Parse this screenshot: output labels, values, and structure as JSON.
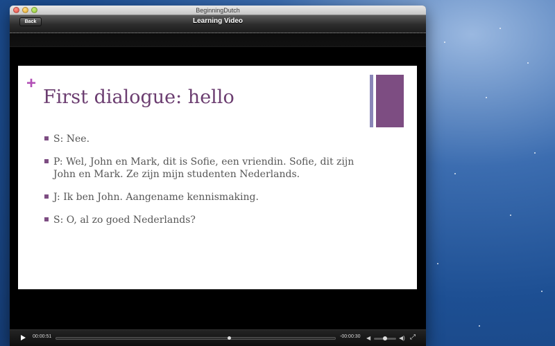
{
  "window": {
    "title": "BeginningDutch"
  },
  "navbar": {
    "back_label": "Back",
    "title": "Learning Video"
  },
  "slide": {
    "plus_symbol": "+",
    "title": "First dialogue: hello",
    "bullets": [
      "S: Nee.",
      "P:  Wel, John en Mark, dit is Sofie, een vriendin. Sofie, dit zijn John en Mark. Ze zijn mijn studenten Nederlands.",
      "J: Ik ben John. Aangename kennismaking.",
      "S: O, al zo goed Nederlands?"
    ],
    "colors": {
      "title": "#6b3d70",
      "accent": "#7d4d82",
      "accent_light": "#8a86b8",
      "plus": "#b24fb6"
    }
  },
  "player": {
    "elapsed": "00:00:51",
    "remaining": "-00:00:30",
    "progress_fraction": 0.62,
    "volume_fraction": 0.5,
    "icons": {
      "play": "play-icon",
      "volume_low": "volume-low-icon",
      "volume_high": "volume-high-icon",
      "fullscreen": "fullscreen-icon"
    }
  }
}
